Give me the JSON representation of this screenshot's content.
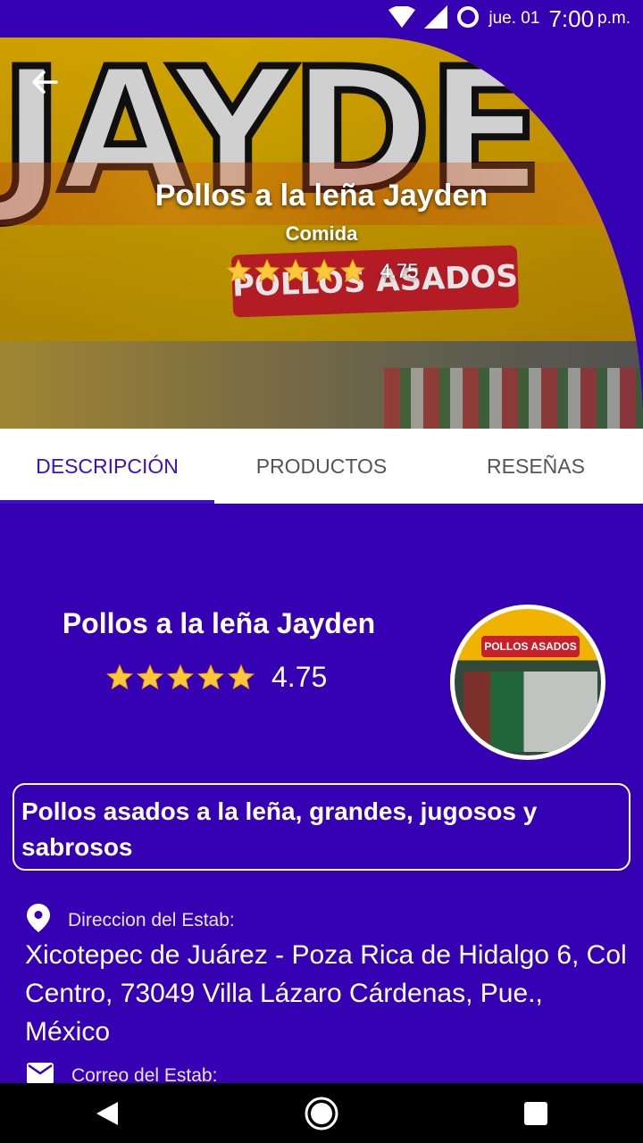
{
  "status_bar": {
    "date": "jue. 01",
    "time": "7:00",
    "ampm": "p.m."
  },
  "header": {
    "title": "Pollos a la leña Jayden",
    "category": "Comida",
    "rating": "4.75",
    "rating_stars": 4.75,
    "sign_text": "JAYDE",
    "banner_text": "POLLOS ASADOS"
  },
  "tabs": [
    {
      "label": "DESCRIPCIÓN",
      "active": true
    },
    {
      "label": "PRODUCTOS",
      "active": false
    },
    {
      "label": "RESEÑAS",
      "active": false
    }
  ],
  "business": {
    "name": "Pollos a la leña Jayden",
    "rating": "4.75",
    "rating_stars": 4.75,
    "avatar_banner": "POLLOS ASADOS",
    "description": "Pollos asados a la leña, grandes, jugosos y sabrosos",
    "address_label": "Direccion del Estab:",
    "address": "Xicotepec de Juárez - Poza Rica de Hidalgo 6, Col Centro, 73049 Villa Lázaro Cárdenas, Pue., México",
    "email_label": "Correo del Estab:"
  },
  "colors": {
    "primary": "#3600b3",
    "accent": "#3a10c9",
    "star": "#ffc83a"
  }
}
